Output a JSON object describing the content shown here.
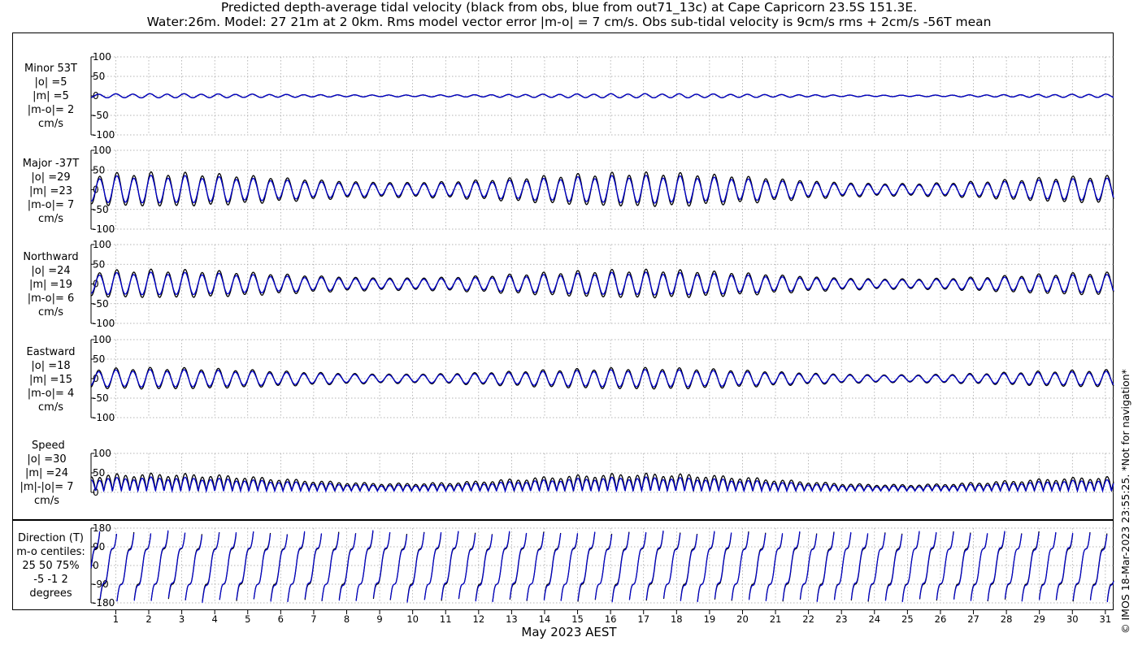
{
  "title_line1": "Predicted depth-average tidal velocity (black from obs, blue from out71_13c) at Cape Capricorn 23.5S 151.3E.",
  "title_line2": "Water:26m. Model: 27 21m at 2 0km. Rms model vector error |m-o| = 7 cm/s. Obs sub-tidal velocity is 9cm/s rms + 2cm/s -56T mean",
  "credit": "© IMOS 18-Mar-2023 23:55:25. *Not for navigation*",
  "chart_data": {
    "type": "line",
    "xlabel": "May 2023 AEST",
    "x_ticks": [
      "1",
      "2",
      "3",
      "4",
      "5",
      "6",
      "7",
      "8",
      "9",
      "10",
      "11",
      "12",
      "13",
      "14",
      "15",
      "16",
      "17",
      "18",
      "19",
      "20",
      "21",
      "22",
      "23",
      "24",
      "25",
      "26",
      "27",
      "28",
      "29",
      "30",
      "31"
    ],
    "xlim": [
      0.25,
      31.25
    ],
    "series_colors": {
      "obs": "#000000",
      "model": "#0000cc"
    },
    "panels": [
      {
        "id": "minor",
        "label_lines": [
          "Minor 53T",
          "|o| =5",
          "|m| =5",
          "|m-o|= 2",
          "cm/s"
        ],
        "ylim": [
          -100,
          100
        ],
        "yticks": [
          "100",
          "50",
          "0",
          "-50",
          "-100"
        ],
        "yvals": [
          100,
          50,
          0,
          -50,
          -100
        ],
        "amp_obs": 5,
        "amp_model": 5,
        "kind": "signed"
      },
      {
        "id": "major",
        "label_lines": [
          "Major -37T",
          "|o| =29",
          "|m| =23",
          "|m-o|= 7",
          "cm/s"
        ],
        "ylim": [
          -100,
          100
        ],
        "yticks": [
          "100",
          "50",
          "0",
          "-50",
          "-100"
        ],
        "yvals": [
          100,
          50,
          0,
          -50,
          -100
        ],
        "amp_obs": 41,
        "amp_model": 33,
        "kind": "signed"
      },
      {
        "id": "north",
        "label_lines": [
          "Northward",
          "|o| =24",
          "|m| =19",
          "|m-o|= 6",
          "cm/s"
        ],
        "ylim": [
          -100,
          100
        ],
        "yticks": [
          "100",
          "50",
          "0",
          "-50",
          "-100"
        ],
        "yvals": [
          100,
          50,
          0,
          -50,
          -100
        ],
        "amp_obs": 34,
        "amp_model": 27,
        "kind": "signed"
      },
      {
        "id": "east",
        "label_lines": [
          "Eastward",
          "|o| =18",
          "|m| =15",
          "|m-o|= 4",
          "cm/s"
        ],
        "ylim": [
          -100,
          100
        ],
        "yticks": [
          "100",
          "50",
          "0",
          "-50",
          "-100"
        ],
        "yvals": [
          100,
          50,
          0,
          -50,
          -100
        ],
        "amp_obs": 26,
        "amp_model": 21,
        "kind": "signed"
      },
      {
        "id": "speed",
        "label_lines": [
          "Speed",
          "|o| =30",
          "|m| =24",
          "|m|-|o|= 7",
          "cm/s"
        ],
        "ylim": [
          0,
          100
        ],
        "yticks": [
          "100",
          "50",
          "0"
        ],
        "yvals": [
          100,
          50,
          0
        ],
        "amp_obs": 41,
        "amp_model": 33,
        "kind": "speed"
      },
      {
        "id": "direction",
        "label_lines": [
          "Direction (T)",
          "m-o centiles:",
          "25  50  75%",
          "-5 -1  2",
          "degrees"
        ],
        "ylim": [
          -180,
          180
        ],
        "yticks": [
          "180",
          "90",
          "0",
          "-90",
          "-180"
        ],
        "yvals": [
          180,
          90,
          0,
          -90,
          -180
        ],
        "kind": "direction"
      }
    ]
  }
}
